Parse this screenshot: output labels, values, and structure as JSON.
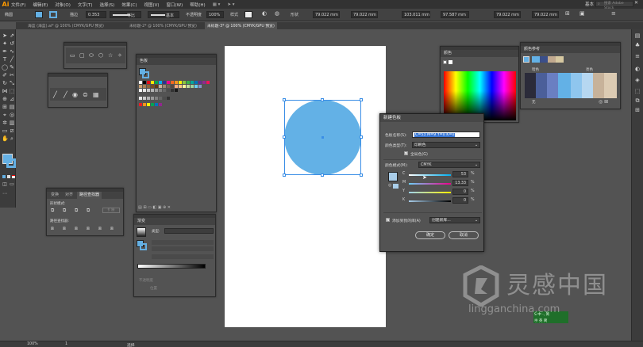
{
  "app": {
    "logo": "Ai"
  },
  "menubar": {
    "items": [
      "文件(F)",
      "编辑(E)",
      "对象(O)",
      "文字(T)",
      "选择(S)",
      "效果(C)",
      "视图(V)",
      "窗口(W)",
      "帮助(H)"
    ],
    "workspace": "基本",
    "search_placeholder": "搜索 Adobe Stock"
  },
  "controlbar": {
    "mode_label": "椭圆",
    "stroke_label": "描边",
    "stroke_value": "0.353",
    "uniform_label": "等比",
    "basic_label": "基本",
    "opacity_label": "不透明度",
    "opacity_value": "100%",
    "style_label": "样式",
    "shape_label": "形状",
    "w_value": "79.022 mm",
    "h_value": "79.022 mm",
    "x_value": "103.011 mm",
    "y_value": "97.587 mm",
    "w2_value": "79.022 mm",
    "h2_value": "79.022 mm"
  },
  "tabs": [
    {
      "label": "海蓝 (海蓝).ai* @ 100% (CMYK/GPU 预览)",
      "active": false
    },
    {
      "label": "未标题-2* @ 100% (CMYK/GPU 预览)",
      "active": false
    },
    {
      "label": "未标题-3* @ 100% (CMYK/GPU 预览)",
      "active": true
    }
  ],
  "swatches_panel": {
    "title": "色板"
  },
  "color_panel": {
    "title": "颜色"
  },
  "color_guide_panel": {
    "title": "颜色参考",
    "col1": "暗色",
    "col2": "亮色",
    "footer": "无"
  },
  "pathfinder_panel": {
    "tabs": [
      "变换",
      "对齐",
      "路径查找器"
    ],
    "shape_modes_label": "形状模式:",
    "expand_label": "扩展",
    "pathfinders_label": "路径查找器:"
  },
  "gradient_panel": {
    "title": "渐变",
    "type_label": "类型:",
    "opacity_label": "不透明度",
    "location_label": "位置"
  },
  "dialog": {
    "title": "新建色板",
    "name_label": "色板名称(S):",
    "name_value": "C=53 M=9 Y=0 K=0",
    "type_label": "颜色类型(T):",
    "type_value": "印刷色",
    "global_label": "全局色(G)",
    "mode_label": "颜色模式(M):",
    "mode_value": "CMYK",
    "channels": [
      {
        "name": "C",
        "value": "53",
        "unit": "%"
      },
      {
        "name": "M",
        "value": "13.33",
        "unit": "%"
      },
      {
        "name": "Y",
        "value": "0",
        "unit": "%"
      },
      {
        "name": "K",
        "value": "0",
        "unit": "%"
      }
    ],
    "add_to_library_label": "添加到我的库(A)",
    "library_value": "创建新库...",
    "ok_label": "确定",
    "cancel_label": "取消"
  },
  "statusbar": {
    "zoom": "100%",
    "page": "1",
    "tool": "选择"
  },
  "watermark": {
    "cn": "灵感中国",
    "url": "lingganchina.com"
  },
  "ime": {
    "line1": "S 中 ·, 简",
    "line2": "㊥ 英 简"
  },
  "colors": {
    "accent": "#63b1e6",
    "selection": "#3a8ee6",
    "panel": "#535353",
    "menubar": "#323232"
  }
}
